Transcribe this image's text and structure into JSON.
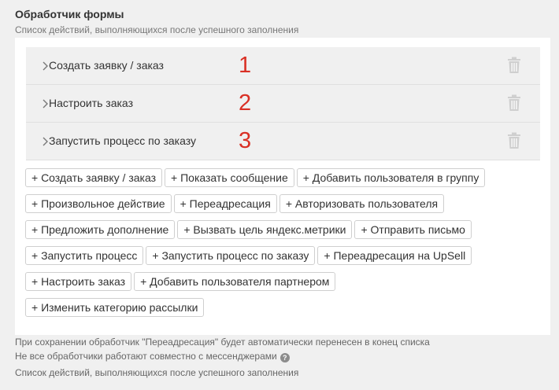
{
  "header": {
    "title": "Обработчик формы",
    "subtitle": "Список действий, выполняющихся после успешного заполнения"
  },
  "actions": [
    {
      "label": "Создать заявку / заказ",
      "number": "1"
    },
    {
      "label": "Настроить заказ",
      "number": "2"
    },
    {
      "label": "Запустить процесс по заказу",
      "number": "3"
    }
  ],
  "add_buttons": [
    [
      "+ Создать заявку / заказ",
      "+ Показать сообщение",
      "+ Добавить пользователя в группу"
    ],
    [
      "+ Произвольное действие",
      "+ Переадресация",
      "+ Авторизовать пользователя"
    ],
    [
      "+ Предложить дополнение",
      "+ Вызвать цель яндекс.метрики",
      "+ Отправить письмо"
    ],
    [
      "+ Запустить процесс",
      "+ Запустить процесс по заказу",
      "+ Переадресация на UpSell"
    ],
    [
      "+ Настроить заказ",
      "+ Добавить пользователя партнером"
    ],
    [
      "+ Изменить категорию рассылки"
    ]
  ],
  "notes": {
    "redirect_note": "При сохранении обработчик \"Переадресация\" будет автоматически перенесен в конец списка",
    "messenger_note": "Не все обработчики работают совместно с мессенджерами",
    "footer_note": "Список действий, выполняющихся после успешного заполнения"
  },
  "icons": {
    "chevron": "chevron-right-icon",
    "delete": "trash-icon",
    "help": "question-circle-icon"
  },
  "colors": {
    "number_red": "#d93025",
    "row_bg": "#f0f0f0",
    "panel_bg": "#ffffff"
  }
}
